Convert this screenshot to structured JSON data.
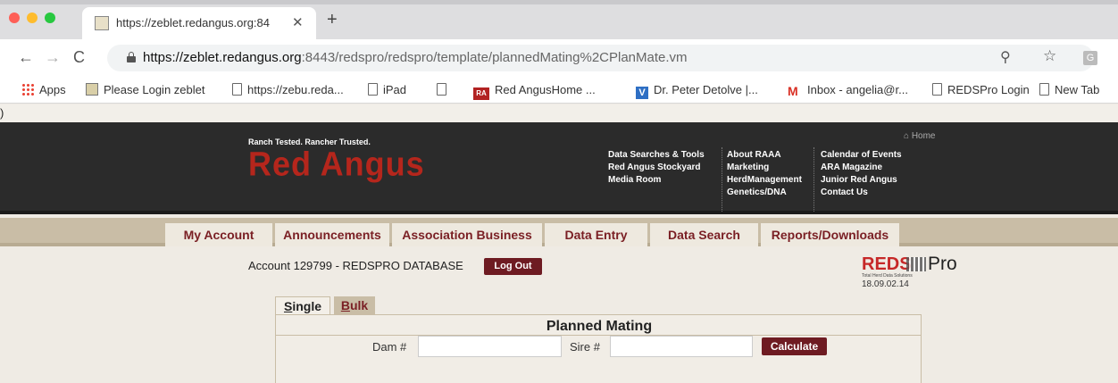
{
  "browser": {
    "tab_title": "https://zeblet.redangus.org:84",
    "url_host": "https://zeblet.redangus.org",
    "url_path": ":8443/redspro/redspro/template/plannedMating%2CPlanMate.vm"
  },
  "bookmarks": [
    {
      "label": "Apps",
      "icon": "apps-grid-icon"
    },
    {
      "label": "Please Login zeblet",
      "icon": "picture-icon"
    },
    {
      "label": "https://zebu.reda...",
      "icon": "page-icon"
    },
    {
      "label": "iPad",
      "icon": "page-icon"
    },
    {
      "label": "",
      "icon": "page-icon"
    },
    {
      "label": "Red AngusHome ...",
      "icon": "ra-icon"
    },
    {
      "label": "Dr. Peter Detolve |...",
      "icon": "v-icon"
    },
    {
      "label": "Inbox - angelia@r...",
      "icon": "gmail-icon"
    },
    {
      "label": "REDSPro Login",
      "icon": "page-icon"
    },
    {
      "label": "New Tab",
      "icon": "page-icon"
    }
  ],
  "stray_text": ")",
  "header": {
    "tagline": "Ranch Tested. Rancher Trusted.",
    "logo": "Red Angus",
    "home": "⌂ Home",
    "menu_col1": [
      "Data Searches & Tools",
      "Red Angus Stockyard",
      "Media Room"
    ],
    "menu_col2": [
      "About RAAA",
      "Marketing",
      "HerdManagement",
      "Genetics/DNA"
    ],
    "menu_col3": [
      "Calendar of Events",
      "ARA Magazine",
      "Junior Red Angus",
      "Contact Us"
    ]
  },
  "nav_tabs": [
    "My Account",
    "Announcements",
    "Association Business",
    "Data Entry",
    "Data Search",
    "Reports/Downloads"
  ],
  "account": {
    "text": "Account 129799 - REDSPRO DATABASE",
    "logout": "Log Out"
  },
  "reds_logo": {
    "word": "REDS",
    "pro": "Pro",
    "sub": "Total Herd Data Solutions",
    "version": "18.09.02.14"
  },
  "mode_tabs": {
    "single_first": "S",
    "single_rest": "ingle",
    "bulk_first": "B",
    "bulk_rest": "ulk"
  },
  "form": {
    "title": "Planned Mating",
    "dam_label": "Dam #",
    "dam_value": "",
    "sire_label": "Sire #",
    "sire_value": "",
    "calculate": "Calculate"
  }
}
